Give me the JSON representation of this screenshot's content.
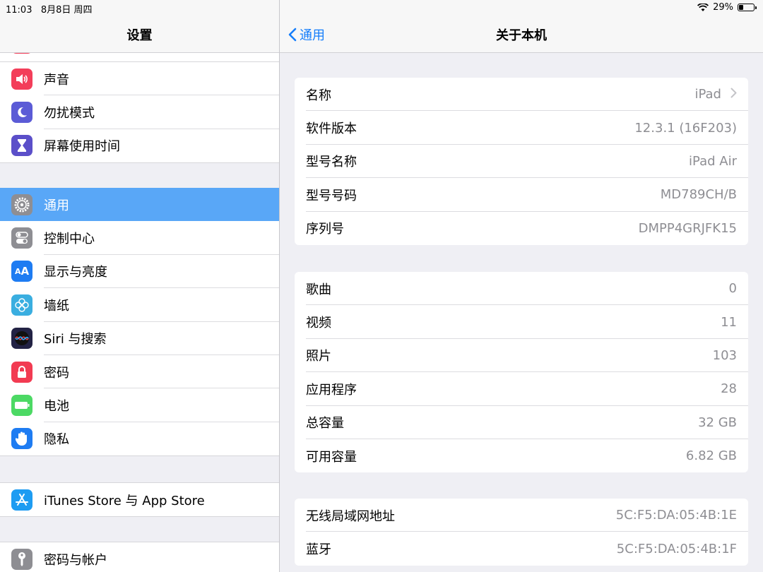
{
  "status": {
    "time": "11:03",
    "date": "8月8日 周四",
    "battery_pct": "29%",
    "battery_level": 0.29
  },
  "master": {
    "title": "设置",
    "group1": [
      {
        "label": "声音",
        "icon": "speaker-icon",
        "color": "#f33e5a"
      },
      {
        "label": "勿扰模式",
        "icon": "moon-icon",
        "color": "#5b5bd6"
      },
      {
        "label": "屏幕使用时间",
        "icon": "hourglass-icon",
        "color": "#5b4fc9"
      }
    ],
    "group2": [
      {
        "label": "通用",
        "icon": "gear-icon",
        "color": "#8e8e93"
      },
      {
        "label": "控制中心",
        "icon": "toggles-icon",
        "color": "#8e8e93"
      },
      {
        "label": "显示与亮度",
        "icon": "text-size-icon",
        "color": "#1e7cf2"
      },
      {
        "label": "墙纸",
        "icon": "flower-icon",
        "color": "#3aaee0"
      },
      {
        "label": "Siri 与搜索",
        "icon": "siri-icon",
        "color": "#222244"
      },
      {
        "label": "密码",
        "icon": "lock-icon",
        "color": "#f23b52"
      },
      {
        "label": "电池",
        "icon": "battery-icon",
        "color": "#4cd964"
      },
      {
        "label": "隐私",
        "icon": "hand-icon",
        "color": "#1e7cf2"
      }
    ],
    "group3": [
      {
        "label": "iTunes Store 与 App Store",
        "icon": "app-store-icon",
        "color": "#1e9cf2"
      }
    ],
    "group4": [
      {
        "label": "密码与帐户",
        "icon": "key-icon",
        "color": "#8e8e93"
      }
    ]
  },
  "detail": {
    "back_label": "通用",
    "title": "关于本机",
    "section1": [
      {
        "key": "名称",
        "value": "iPad"
      },
      {
        "key": "软件版本",
        "value": "12.3.1 (16F203)"
      },
      {
        "key": "型号名称",
        "value": "iPad Air"
      },
      {
        "key": "型号号码",
        "value": "MD789CH/B"
      },
      {
        "key": "序列号",
        "value": "DMPP4GRJFK15"
      }
    ],
    "section2": [
      {
        "key": "歌曲",
        "value": "0"
      },
      {
        "key": "视频",
        "value": "11"
      },
      {
        "key": "照片",
        "value": "103"
      },
      {
        "key": "应用程序",
        "value": "28"
      },
      {
        "key": "总容量",
        "value": "32 GB"
      },
      {
        "key": "可用容量",
        "value": "6.82 GB"
      }
    ],
    "section3": [
      {
        "key": "无线局域网地址",
        "value": "5C:F5:DA:05:4B:1E"
      },
      {
        "key": "蓝牙",
        "value": "5C:F5:DA:05:4B:1F"
      }
    ]
  }
}
